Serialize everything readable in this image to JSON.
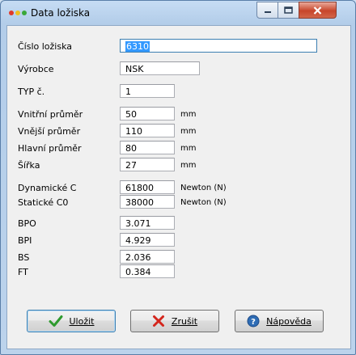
{
  "window": {
    "title": "Data ložiska"
  },
  "fields": {
    "cislo_loziska": {
      "label": "Číslo ložiska",
      "value": "6310"
    },
    "vyrobce": {
      "label": "Výrobce",
      "value": "NSK"
    },
    "typ": {
      "label": "TYP č.",
      "value": "1"
    },
    "vnitrni_prumer": {
      "label": "Vnitřní průměr",
      "value": "50",
      "unit": "mm"
    },
    "vnejsi_prumer": {
      "label": "Vnější průměr",
      "value": "110",
      "unit": "mm"
    },
    "hlavni_prumer": {
      "label": "Hlavní průměr",
      "value": "80",
      "unit": "mm"
    },
    "sirka": {
      "label": "Šířka",
      "value": "27",
      "unit": "mm"
    },
    "dynamicke_c": {
      "label": "Dynamické C",
      "value": "61800",
      "unit": "Newton (N)"
    },
    "staticke_c0": {
      "label": "Statické C0",
      "value": "38000",
      "unit": "Newton (N)"
    },
    "bpo": {
      "label": "BPO",
      "value": "3.071"
    },
    "bpi": {
      "label": "BPI",
      "value": "4.929"
    },
    "bs": {
      "label": "BS",
      "value": "2.036"
    },
    "ft": {
      "label": "FT",
      "value": "0.384"
    }
  },
  "buttons": {
    "save": {
      "label": "Uložit",
      "icon": "checkmark-icon"
    },
    "cancel": {
      "label": "Zrušit",
      "icon": "red-x-icon"
    },
    "help": {
      "label": "Nápověda",
      "icon": "help-question-icon"
    }
  },
  "colors": {
    "selection": "#3399ff",
    "client_bg": "#f0f0f0",
    "frame": "#bcd3ec"
  }
}
